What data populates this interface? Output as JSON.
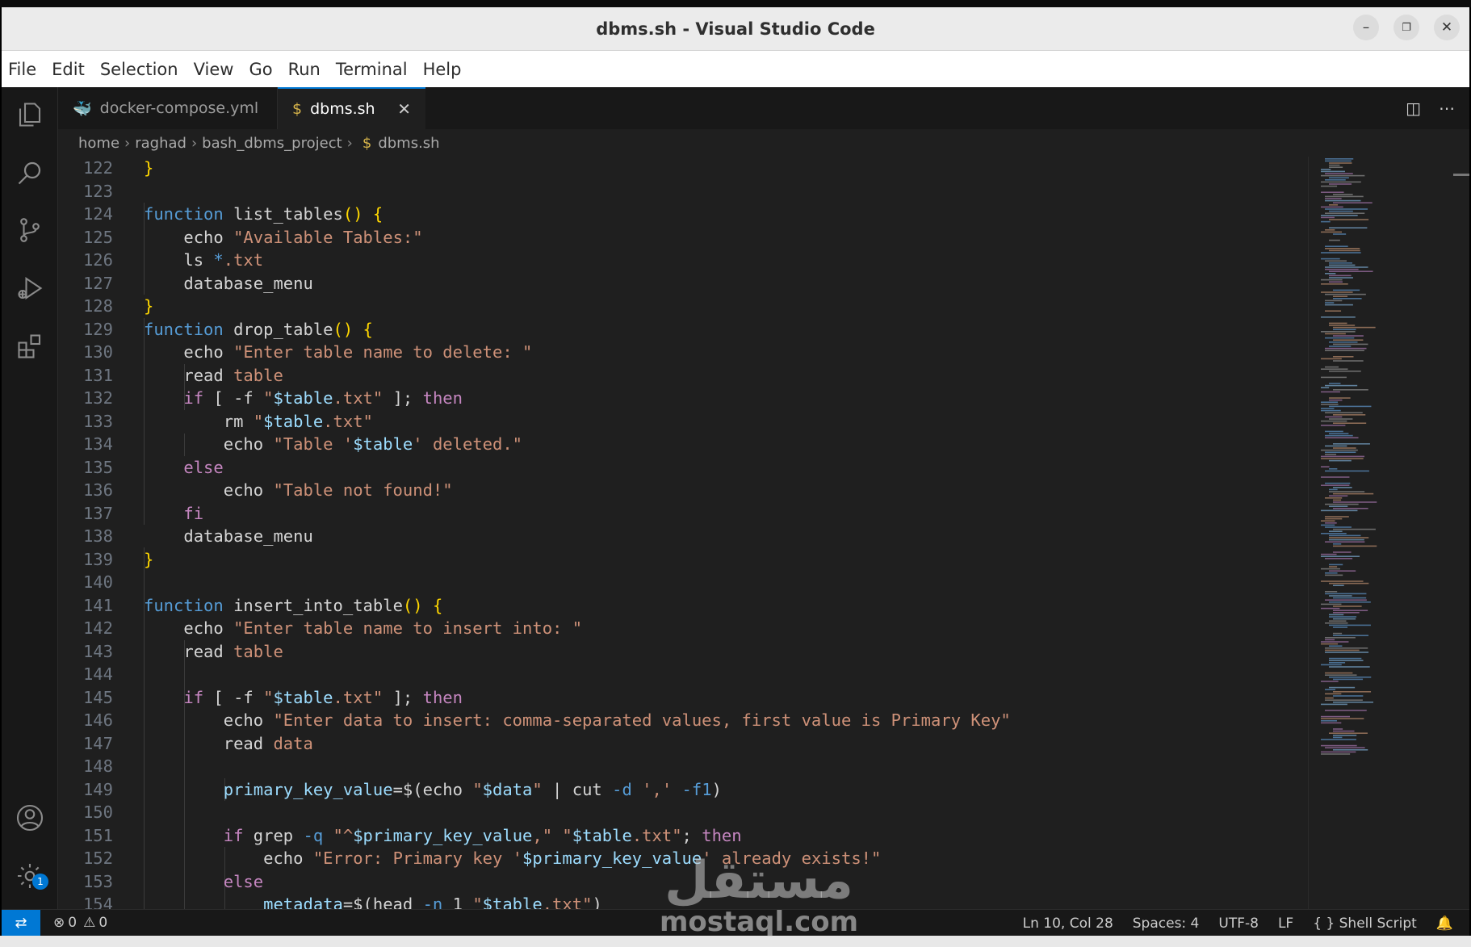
{
  "window": {
    "title": "dbms.sh - Visual Studio Code"
  },
  "menu": [
    "File",
    "Edit",
    "Selection",
    "View",
    "Go",
    "Run",
    "Terminal",
    "Help"
  ],
  "activity_icons": [
    "explorer-icon",
    "search-icon",
    "source-control-icon",
    "run-debug-icon",
    "extensions-icon",
    "account-icon",
    "settings-gear-icon"
  ],
  "settings_badge": "1",
  "tabs": [
    {
      "label": "docker-compose.yml",
      "icon": "docker-icon",
      "active": false
    },
    {
      "label": "dbms.sh",
      "icon": "$",
      "active": true
    }
  ],
  "breadcrumb": [
    "home",
    "raghad",
    "bash_dbms_project",
    "dbms.sh"
  ],
  "code": [
    {
      "n": "122",
      "tokens": [
        [
          "}",
          "b"
        ]
      ]
    },
    {
      "n": "123",
      "tokens": []
    },
    {
      "n": "124",
      "tokens": [
        [
          "function",
          "k"
        ],
        [
          " list_tables",
          "t"
        ],
        [
          "()",
          "b"
        ],
        [
          " {",
          "b"
        ]
      ]
    },
    {
      "n": "125",
      "tokens": [
        [
          "    echo ",
          "t"
        ],
        [
          "\"Available Tables:\"",
          "s"
        ]
      ]
    },
    {
      "n": "126",
      "tokens": [
        [
          "    ls ",
          "t"
        ],
        [
          "*",
          "k"
        ],
        [
          ".txt",
          "s"
        ]
      ]
    },
    {
      "n": "127",
      "tokens": [
        [
          "    database_menu",
          "t"
        ]
      ]
    },
    {
      "n": "128",
      "tokens": [
        [
          "}",
          "b"
        ]
      ]
    },
    {
      "n": "129",
      "tokens": [
        [
          "function",
          "k"
        ],
        [
          " drop_table",
          "t"
        ],
        [
          "()",
          "b"
        ],
        [
          " {",
          "b"
        ]
      ]
    },
    {
      "n": "130",
      "tokens": [
        [
          "    echo ",
          "t"
        ],
        [
          "\"Enter table name to delete: \"",
          "s"
        ]
      ]
    },
    {
      "n": "131",
      "tokens": [
        [
          "    read ",
          "t"
        ],
        [
          "table",
          "s"
        ]
      ]
    },
    {
      "n": "132",
      "tokens": [
        [
          "    ",
          "t"
        ],
        [
          "if",
          "c"
        ],
        [
          " [ -f ",
          "t"
        ],
        [
          "\"",
          "s"
        ],
        [
          "$table",
          "v"
        ],
        [
          ".txt\"",
          "s"
        ],
        [
          " ]; ",
          "t"
        ],
        [
          "then",
          "c"
        ]
      ]
    },
    {
      "n": "133",
      "tokens": [
        [
          "        rm ",
          "t"
        ],
        [
          "\"",
          "s"
        ],
        [
          "$table",
          "v"
        ],
        [
          ".txt\"",
          "s"
        ]
      ]
    },
    {
      "n": "134",
      "tokens": [
        [
          "        echo ",
          "t"
        ],
        [
          "\"Table '",
          "s"
        ],
        [
          "$table",
          "v"
        ],
        [
          "' deleted.\"",
          "s"
        ]
      ]
    },
    {
      "n": "135",
      "tokens": [
        [
          "    ",
          "t"
        ],
        [
          "else",
          "c"
        ]
      ]
    },
    {
      "n": "136",
      "tokens": [
        [
          "        echo ",
          "t"
        ],
        [
          "\"Table not found!\"",
          "s"
        ]
      ]
    },
    {
      "n": "137",
      "tokens": [
        [
          "    ",
          "t"
        ],
        [
          "fi",
          "c"
        ]
      ]
    },
    {
      "n": "138",
      "tokens": [
        [
          "    database_menu",
          "t"
        ]
      ]
    },
    {
      "n": "139",
      "tokens": [
        [
          "}",
          "b"
        ]
      ]
    },
    {
      "n": "140",
      "tokens": []
    },
    {
      "n": "141",
      "tokens": [
        [
          "function",
          "k"
        ],
        [
          " insert_into_table",
          "t"
        ],
        [
          "()",
          "b"
        ],
        [
          " {",
          "b"
        ]
      ]
    },
    {
      "n": "142",
      "tokens": [
        [
          "    echo ",
          "t"
        ],
        [
          "\"Enter table name to insert into: \"",
          "s"
        ]
      ]
    },
    {
      "n": "143",
      "tokens": [
        [
          "    read ",
          "t"
        ],
        [
          "table",
          "s"
        ]
      ]
    },
    {
      "n": "144",
      "tokens": []
    },
    {
      "n": "145",
      "tokens": [
        [
          "    ",
          "t"
        ],
        [
          "if",
          "c"
        ],
        [
          " [ -f ",
          "t"
        ],
        [
          "\"",
          "s"
        ],
        [
          "$table",
          "v"
        ],
        [
          ".txt\"",
          "s"
        ],
        [
          " ]; ",
          "t"
        ],
        [
          "then",
          "c"
        ]
      ]
    },
    {
      "n": "146",
      "tokens": [
        [
          "        echo ",
          "t"
        ],
        [
          "\"Enter data to insert: comma-separated values, first value is Primary Key\"",
          "s"
        ]
      ]
    },
    {
      "n": "147",
      "tokens": [
        [
          "        read ",
          "t"
        ],
        [
          "data",
          "s"
        ]
      ]
    },
    {
      "n": "148",
      "tokens": []
    },
    {
      "n": "149",
      "tokens": [
        [
          "        primary_key_value",
          "v"
        ],
        [
          "=$(",
          "t"
        ],
        [
          "echo ",
          "t"
        ],
        [
          "\"",
          "s"
        ],
        [
          "$data",
          "v"
        ],
        [
          "\"",
          "s"
        ],
        [
          " | cut ",
          "t"
        ],
        [
          "-d",
          "k"
        ],
        [
          " ','",
          "s"
        ],
        [
          " -f1",
          "k"
        ],
        [
          ")",
          "t"
        ]
      ]
    },
    {
      "n": "150",
      "tokens": []
    },
    {
      "n": "151",
      "tokens": [
        [
          "        ",
          "t"
        ],
        [
          "if",
          "c"
        ],
        [
          " grep ",
          "t"
        ],
        [
          "-q",
          "k"
        ],
        [
          " \"^",
          "s"
        ],
        [
          "$primary_key_value",
          "v"
        ],
        [
          ",\"",
          "s"
        ],
        [
          " \"",
          "s"
        ],
        [
          "$table",
          "v"
        ],
        [
          ".txt\"",
          "s"
        ],
        [
          "; ",
          "t"
        ],
        [
          "then",
          "c"
        ]
      ]
    },
    {
      "n": "152",
      "tokens": [
        [
          "            echo ",
          "t"
        ],
        [
          "\"Error: Primary key '",
          "s"
        ],
        [
          "$primary_key_value",
          "v"
        ],
        [
          "' already exists!\"",
          "s"
        ]
      ]
    },
    {
      "n": "153",
      "tokens": [
        [
          "        ",
          "t"
        ],
        [
          "else",
          "c"
        ]
      ]
    },
    {
      "n": "154",
      "tokens": [
        [
          "            metadata",
          "v"
        ],
        [
          "=$(",
          "t"
        ],
        [
          "head ",
          "t"
        ],
        [
          "-n",
          "k"
        ],
        [
          " 1 ",
          "t"
        ],
        [
          "\"",
          "s"
        ],
        [
          "$table",
          "v"
        ],
        [
          ".txt\"",
          "s"
        ],
        [
          ")",
          "t"
        ]
      ]
    }
  ],
  "status": {
    "errors": "0",
    "warnings": "0",
    "position": "Ln 10, Col 28",
    "spaces": "Spaces: 4",
    "encoding": "UTF-8",
    "eol": "LF",
    "language": "Shell Script"
  },
  "watermark": {
    "arabic": "مستقل",
    "latin": "mostaql.com"
  }
}
